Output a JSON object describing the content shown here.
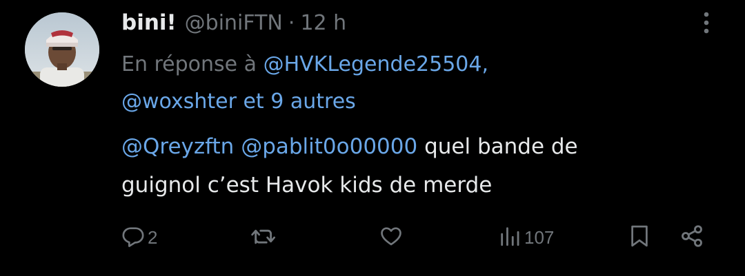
{
  "tweet": {
    "display_name": "bini!",
    "handle": "@biniFTN",
    "separator": "·",
    "time": "12 h",
    "reply_prefix": "En réponse à",
    "reply_user_1": "@HVKLegende25504,",
    "reply_user_2": "@woxshter",
    "reply_joiner": "et",
    "reply_others": "9 autres",
    "mention_1": "@Qreyzftn",
    "mention_2": "@pablit0o00000",
    "text_line_1": " quel bande de",
    "text_line_2": "guignol c’est Havok kids de merde"
  },
  "actions": {
    "reply_count": "2",
    "retweet_count": "",
    "like_count": "",
    "views_count": "107"
  },
  "colors": {
    "background": "#000000",
    "text": "#e7e9ea",
    "muted": "#71767b",
    "link": "#6aa7e8"
  },
  "icons": {
    "more": "more-vertical-icon",
    "reply": "reply-icon",
    "retweet": "retweet-icon",
    "like": "heart-icon",
    "views": "views-icon",
    "bookmark": "bookmark-icon",
    "share": "share-icon"
  }
}
